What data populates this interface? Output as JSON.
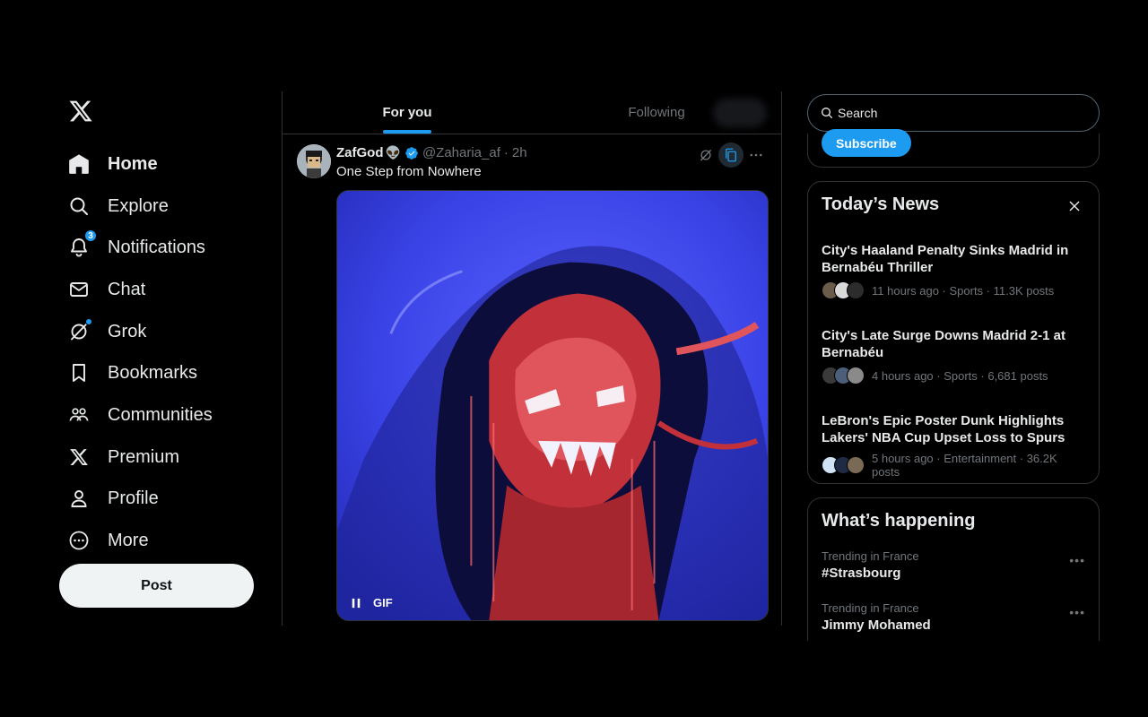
{
  "nav": {
    "items": [
      {
        "label": "Home",
        "icon": "home-icon",
        "active": true
      },
      {
        "label": "Explore",
        "icon": "search-icon"
      },
      {
        "label": "Notifications",
        "icon": "bell-icon",
        "badge": "3"
      },
      {
        "label": "Chat",
        "icon": "mail-icon"
      },
      {
        "label": "Grok",
        "icon": "grok-icon"
      },
      {
        "label": "Bookmarks",
        "icon": "bookmark-icon"
      },
      {
        "label": "Communities",
        "icon": "communities-icon"
      },
      {
        "label": "Premium",
        "icon": "x-logo-icon"
      },
      {
        "label": "Profile",
        "icon": "profile-icon"
      },
      {
        "label": "More",
        "icon": "more-circle-icon"
      }
    ],
    "post_label": "Post"
  },
  "feed": {
    "tabs": [
      {
        "label": "For you",
        "active": true
      },
      {
        "label": "Following",
        "active": false
      }
    ],
    "tweet": {
      "name": "ZafGod",
      "name_emoji": "👽",
      "handle": "@Zaharia_af",
      "separator": "·",
      "time": "2h",
      "text": "One Step from Nowhere",
      "media_label": "GIF"
    }
  },
  "sidebar": {
    "search_placeholder": "Search",
    "subscribe_label": "Subscribe",
    "news": {
      "title": "Today’s News",
      "items": [
        {
          "title": "City's Haaland Penalty Sinks Madrid in Bernabéu Thriller",
          "meta": "11 hours ago · Sports · 11.3K posts"
        },
        {
          "title": "City's Late Surge Downs Madrid 2-1 at Bernabéu",
          "meta": "4 hours ago · Sports · 6,681 posts"
        },
        {
          "title": "LeBron's Epic Poster Dunk Highlights Lakers' NBA Cup Upset Loss to Spurs",
          "meta": "5 hours ago · Entertainment · 36.2K posts"
        }
      ]
    },
    "happening": {
      "title": "What’s happening",
      "trends": [
        {
          "category": "Trending in France",
          "name": "#Strasbourg"
        },
        {
          "category": "Trending in France",
          "name": "Jimmy Mohamed"
        }
      ]
    }
  },
  "colors": {
    "accent": "#1d9bf0",
    "background": "#000000",
    "border": "#2f3336",
    "text": "#e7e9ea",
    "muted": "#71767b"
  }
}
